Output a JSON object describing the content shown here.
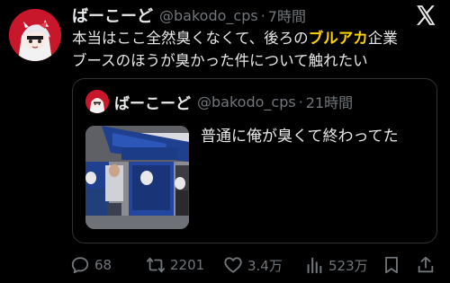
{
  "tweet": {
    "display_name": "ばーこーど",
    "handle": "@bakodo_cps",
    "separator": "·",
    "time": "7時間",
    "text_line1_pre": "本当はここ全然臭くなくて、後ろの",
    "text_line1_highlight": "ブルアカ",
    "text_line1_post": "企業",
    "text_line2": "ブースのほうが臭かった件について触れたい"
  },
  "quote": {
    "display_name": "ばーこーど",
    "handle": "@bakodo_cps",
    "separator": "·",
    "time": "21時間",
    "text": "普通に俺が臭くて終わってた"
  },
  "actions": {
    "reply_count": "68",
    "retweet_count": "2201",
    "like_count": "3.4万",
    "view_count": "523万"
  },
  "icons": {
    "top_right": "x-logo-icon",
    "reply": "reply-icon",
    "retweet": "retweet-icon",
    "like": "heart-icon",
    "views": "views-icon",
    "bookmark": "bookmark-icon",
    "share": "share-icon"
  },
  "colors": {
    "background": "#000000",
    "text": "#e7e9ea",
    "secondary": "#71767b",
    "highlight": "#ffd400",
    "border": "#2f3336",
    "avatar_bg": "#c8172b"
  }
}
